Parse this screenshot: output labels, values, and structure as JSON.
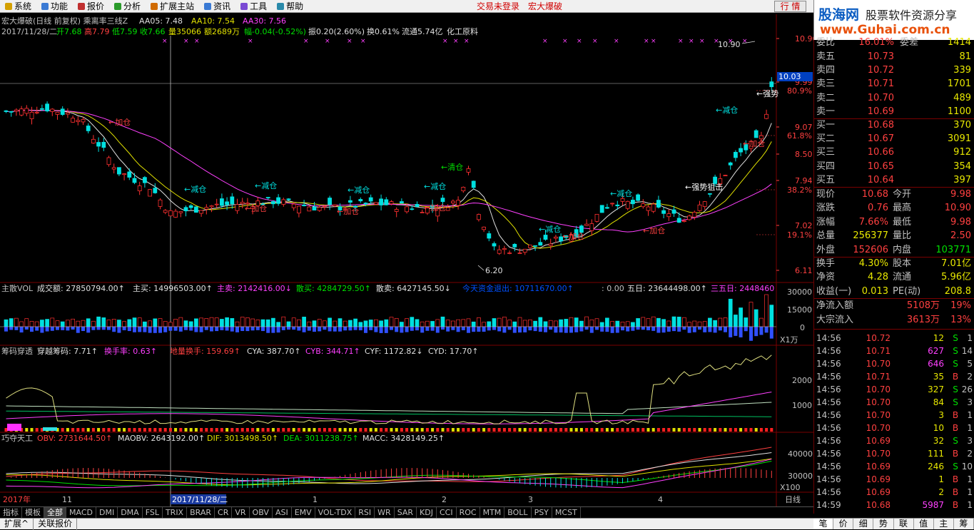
{
  "menu": [
    {
      "label": "系统",
      "icon": "system-icon"
    },
    {
      "label": "功能",
      "icon": "function-icon"
    },
    {
      "label": "报价",
      "icon": "quote-icon"
    },
    {
      "label": "分析",
      "icon": "analysis-icon"
    },
    {
      "label": "扩展主站",
      "icon": "extend-icon"
    },
    {
      "label": "资讯",
      "icon": "news-icon"
    },
    {
      "label": "工具",
      "icon": "tools-icon"
    },
    {
      "label": "帮助",
      "icon": "help-icon"
    }
  ],
  "status": {
    "trade": "交易未登录",
    "stock_name": "宏大爆破",
    "quote_button": "行 情"
  },
  "logo": {
    "site": "股海网",
    "slogan": "股票软件资源分享",
    "url": "www.Guhai.com.cn"
  },
  "main": {
    "title": "宏大爆破(日线 前复权) 乘离率三线Z",
    "aa05": "AA05: 7.48",
    "aa10": "AA10: 7.54",
    "aa30": "AA30: 7.56",
    "info_date": "2017/11/28/二",
    "info_open": "开7.68",
    "info_high": "高7.79",
    "info_low": "低7.59",
    "info_close": "收7.66",
    "info_vol": "量35066",
    "info_amt": "额2689万",
    "info_chg": "幅-0.04(-0.52%)",
    "info_amp": "振0.20(2.60%)",
    "info_turn": "换0.61%",
    "info_float": "流通5.74亿",
    "info_ind": "化工原料",
    "price_axis": [
      "10.90",
      "9.99",
      "80.9%",
      "9.07",
      "61.8%",
      "8.50",
      "7.94",
      "38.2%",
      "7.02",
      "19.1%",
      "6.11"
    ],
    "cur_price": "10.03",
    "high_mark": "10.90",
    "low_mark": "6.20",
    "annotations": [
      {
        "text": "←清仓",
        "color": "#00e000"
      },
      {
        "text": "←减仓",
        "color": "#00e0e0"
      },
      {
        "text": "←减仓",
        "color": "#00e0e0"
      },
      {
        "text": "←减仓",
        "color": "#00e0e0"
      },
      {
        "text": "←减仓",
        "color": "#00e0e0"
      },
      {
        "text": "←减仓",
        "color": "#00e0e0"
      },
      {
        "text": "←减仓",
        "color": "#00e0e0"
      },
      {
        "text": "←减仓",
        "color": "#00e0e0"
      },
      {
        "text": "←加仓",
        "color": "#ff4040"
      },
      {
        "text": "←加仓",
        "color": "#ff4040"
      },
      {
        "text": "←加仓",
        "color": "#ff4040"
      },
      {
        "text": "←加仓",
        "color": "#ff4040"
      },
      {
        "text": "←加仓",
        "color": "#ff4040"
      },
      {
        "text": "←加仓",
        "color": "#ff4040"
      },
      {
        "text": "←加仓",
        "color": "#ff4040"
      },
      {
        "text": "←强势狙击",
        "color": "#ffffff"
      },
      {
        "text": "←强势",
        "color": "#ffffff"
      }
    ]
  },
  "vol": {
    "label": "主散VOL",
    "amount": "成交额: 27850794.00↑",
    "main_buy": "主买: 14996503.00↑",
    "main_sell": "主卖: 2142416.00↓",
    "retail_buy": "散买: 4284729.50↑",
    "retail_sell": "散卖: 6427145.50↓",
    "fund_out": "今天资金退出: 10711670.00↑",
    "zero": ": 0.00",
    "five": "五日: 23644498.00↑",
    "thirty": "三五日: 2448460",
    "axis": [
      "30000",
      "15000",
      "0"
    ],
    "unit": "X1万"
  },
  "chip": {
    "label": "筹码穿透",
    "cross": "穿越筹码: 7.71↑",
    "turnover": "换手率: 0.63↑",
    "low_turn": "地量换手: 159.69↑",
    "cya": "CYA: 387.70↑",
    "cyb": "CYB: 344.71↑",
    "cyf": "CYF: 1172.82↓",
    "cyd": "CYD: 17.70↑",
    "axis": [
      "2000",
      "1000"
    ]
  },
  "macd": {
    "label": "巧夺天工",
    "obv": "OBV: 2731644.50↑",
    "maobv": "MAOBV: 2643192.00↑",
    "dif": "DIF: 3013498.50↑",
    "dea": "DEA: 3011238.75↑",
    "macc": "MACC: 3428149.25↑",
    "axis": [
      "40000",
      "30000"
    ],
    "unit": "X100"
  },
  "xaxis": {
    "year": "2017年",
    "m11": "11",
    "cursor": "2017/11/28/二",
    "m1": "1",
    "m2": "2",
    "m3": "3",
    "m4": "4",
    "period": "日线"
  },
  "tabs": [
    "指标",
    "模板",
    "全部",
    "MACD",
    "DMI",
    "DMA",
    "FSL",
    "TRIX",
    "BRAR",
    "CR",
    "VR",
    "OBV",
    "ASI",
    "EMV",
    "VOL-TDX",
    "RSI",
    "WR",
    "SAR",
    "KDJ",
    "CCI",
    "ROC",
    "MTM",
    "BOLL",
    "PSY",
    "MCST"
  ],
  "bottom": [
    "扩展^",
    "关联报价"
  ],
  "orderbook": {
    "top": {
      "label": "委比",
      "value": "16.01%",
      "label2": "委差",
      "value2": "1414"
    },
    "sell": [
      {
        "label": "卖五",
        "price": "10.73",
        "vol": "81"
      },
      {
        "label": "卖四",
        "price": "10.72",
        "vol": "339"
      },
      {
        "label": "卖三",
        "price": "10.71",
        "vol": "1701"
      },
      {
        "label": "卖二",
        "price": "10.70",
        "vol": "489"
      },
      {
        "label": "卖一",
        "price": "10.69",
        "vol": "1100"
      }
    ],
    "buy": [
      {
        "label": "买一",
        "price": "10.68",
        "vol": "370"
      },
      {
        "label": "买二",
        "price": "10.67",
        "vol": "3091"
      },
      {
        "label": "买三",
        "price": "10.66",
        "vol": "912"
      },
      {
        "label": "买四",
        "price": "10.65",
        "vol": "354"
      },
      {
        "label": "买五",
        "price": "10.64",
        "vol": "397"
      }
    ]
  },
  "stats": [
    {
      "a": "现价",
      "b": "10.68",
      "bc": "red",
      "c": "今开",
      "d": "9.98",
      "dc": "red"
    },
    {
      "a": "涨跌",
      "b": "0.76",
      "bc": "red",
      "c": "最高",
      "d": "10.90",
      "dc": "red"
    },
    {
      "a": "涨幅",
      "b": "7.66%",
      "bc": "red",
      "c": "最低",
      "d": "9.98",
      "dc": "red"
    },
    {
      "a": "总量",
      "b": "256377",
      "bc": "yel",
      "c": "量比",
      "d": "2.50",
      "dc": "red"
    },
    {
      "a": "外盘",
      "b": "152606",
      "bc": "red",
      "c": "内盘",
      "d": "103771",
      "dc": "grn"
    }
  ],
  "stats2": [
    {
      "a": "换手",
      "b": "4.30%",
      "bc": "yel",
      "c": "股本",
      "d": "7.01亿",
      "dc": "yel"
    },
    {
      "a": "净资",
      "b": "4.28",
      "bc": "yel",
      "c": "流通",
      "d": "5.96亿",
      "dc": "yel"
    },
    {
      "a": "收益(一)",
      "b": "0.013",
      "bc": "yel",
      "c": "PE(动)",
      "d": "208.8",
      "dc": "yel"
    }
  ],
  "flows": [
    {
      "a": "净流入额",
      "b": "5108万",
      "c": "19%"
    },
    {
      "a": "大宗流入",
      "b": "3613万",
      "c": "13%"
    }
  ],
  "ticks": [
    {
      "t": "14:56",
      "p": "10.72",
      "v": "12",
      "s": "S",
      "n": "1"
    },
    {
      "t": "14:56",
      "p": "10.71",
      "v": "627",
      "s": "S",
      "n": "14"
    },
    {
      "t": "14:56",
      "p": "10.70",
      "v": "646",
      "s": "S",
      "n": "5"
    },
    {
      "t": "14:56",
      "p": "10.71",
      "v": "35",
      "s": "B",
      "n": "2"
    },
    {
      "t": "14:56",
      "p": "10.70",
      "v": "327",
      "s": "S",
      "n": "26"
    },
    {
      "t": "14:56",
      "p": "10.70",
      "v": "84",
      "s": "S",
      "n": "3"
    },
    {
      "t": "14:56",
      "p": "10.70",
      "v": "3",
      "s": "B",
      "n": "1"
    },
    {
      "t": "14:56",
      "p": "10.70",
      "v": "10",
      "s": "B",
      "n": "1"
    },
    {
      "t": "14:56",
      "p": "10.69",
      "v": "32",
      "s": "S",
      "n": "3"
    },
    {
      "t": "14:56",
      "p": "10.70",
      "v": "111",
      "s": "B",
      "n": "2"
    },
    {
      "t": "14:56",
      "p": "10.69",
      "v": "246",
      "s": "S",
      "n": "10"
    },
    {
      "t": "14:56",
      "p": "10.69",
      "v": "1",
      "s": "B",
      "n": "1"
    },
    {
      "t": "14:56",
      "p": "10.69",
      "v": "2",
      "s": "B",
      "n": "1"
    },
    {
      "t": "14:59",
      "p": "10.68",
      "v": "5987",
      "s": "B",
      "n": "1"
    }
  ],
  "rtabs": [
    "笔",
    "价",
    "细",
    "势",
    "联",
    "值",
    "主",
    "筹"
  ]
}
